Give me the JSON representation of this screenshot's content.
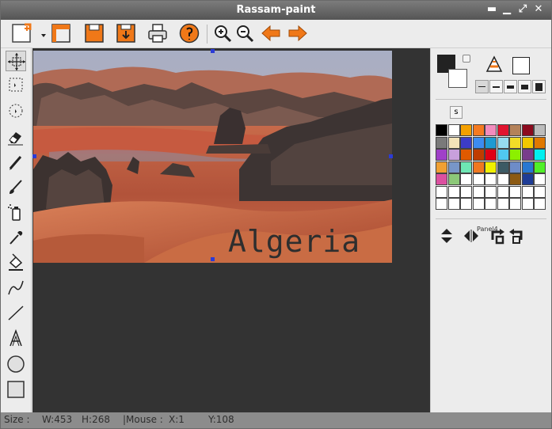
{
  "window": {
    "title": "Rassam-paint"
  },
  "toolbar": {
    "buttons": [
      "new-document",
      "open",
      "save",
      "save-as",
      "print",
      "undo-history",
      "zoom-in",
      "zoom-out",
      "back",
      "forward"
    ]
  },
  "tools": [
    "move-selection",
    "rect-select",
    "lasso-select",
    "eraser",
    "pencil",
    "brush",
    "spray",
    "color-picker",
    "fill-bucket",
    "curve",
    "line",
    "text",
    "ellipse",
    "rectangle"
  ],
  "canvas": {
    "overlay_text": "Algeria"
  },
  "right_panel": {
    "primary_color": "#222222",
    "secondary_color": "#ffffff",
    "s_button_label": "s",
    "panel_label": "Panel4",
    "palette": [
      [
        "#000000",
        "#ffffff",
        "#f4a000",
        "#f47a20",
        "#f28cbd",
        "#e0142e",
        "#b4825a",
        "#8c0a1e",
        "#bcbcbc"
      ],
      [
        "#7a7a7a",
        "#f3e3b8",
        "#3c3cc8",
        "#3c8cf0",
        "#1e9ad2",
        "#96dcf0",
        "#f0dc28",
        "#f0c800",
        "#e07800"
      ],
      [
        "#a040c8",
        "#c8a0dc",
        "#e05a00",
        "#c03c00",
        "#e00014",
        "#50c8f0",
        "#8cf000",
        "#783c8c",
        "#00f0f0"
      ],
      [
        "#f0a032",
        "#7896c8",
        "#6ee6b4",
        "#f07820",
        "#f0f000",
        "#3c5a64",
        "#6e8cc8",
        "#2878d2",
        "#50f028"
      ],
      [
        "#dc50a0",
        "#8cc878",
        "#ffffff",
        "#ffffff",
        "#ffffff",
        "#ffffff",
        "#8c5a14",
        "#1e3c96",
        "#ffffff"
      ],
      [
        "#ffffff",
        "#ffffff",
        "#ffffff",
        "#ffffff",
        "#ffffff",
        "#ffffff",
        "#ffffff",
        "#ffffff",
        "#ffffff"
      ],
      [
        "#ffffff",
        "#ffffff",
        "#ffffff",
        "#ffffff",
        "#ffffff",
        "#ffffff",
        "#ffffff",
        "#ffffff",
        "#ffffff"
      ]
    ]
  },
  "status": {
    "size_label": "Size :",
    "width": "W:453",
    "height": "H:268",
    "mouse_label": "|Mouse :",
    "mouse_x": "X:1",
    "mouse_y": "Y:108"
  }
}
